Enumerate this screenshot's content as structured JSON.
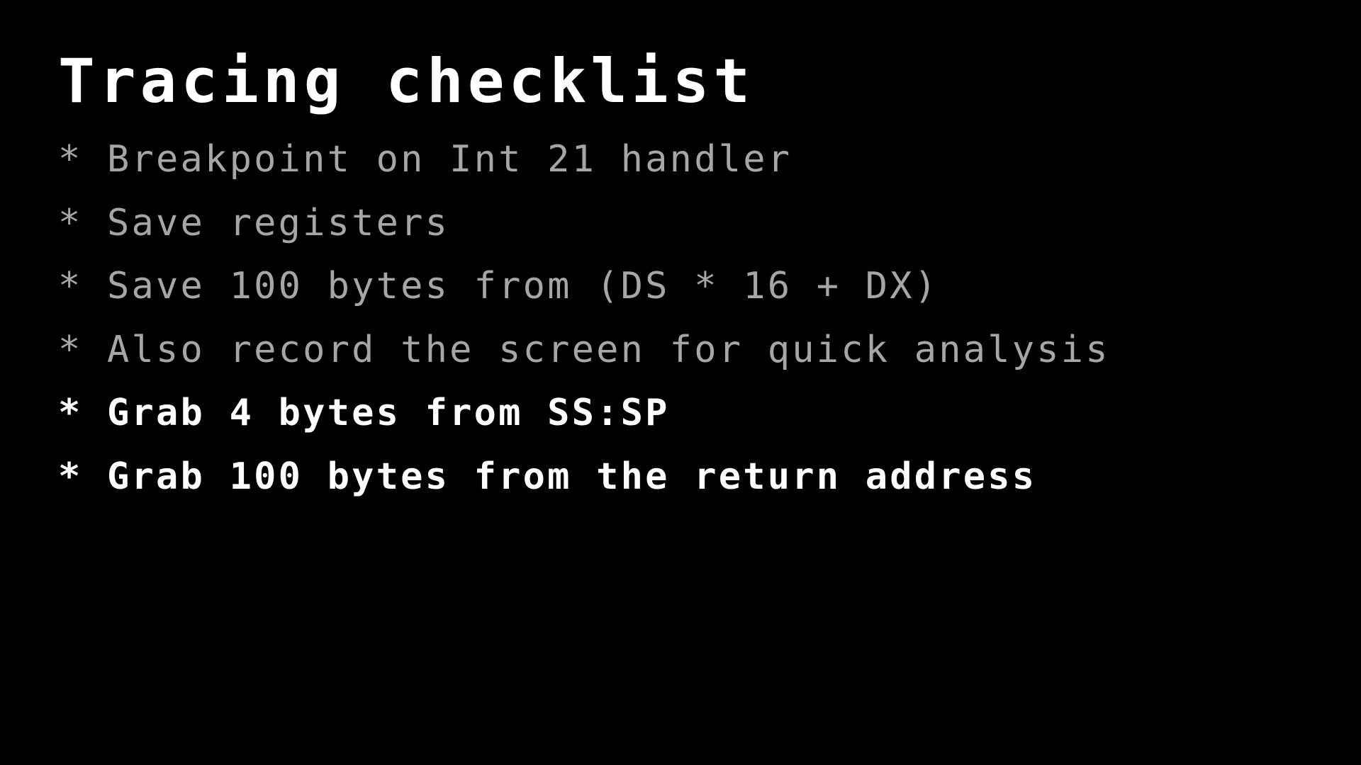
{
  "slide": {
    "background_color": "#000000",
    "title": "Tracing checklist",
    "title_color": "#ffffff",
    "dim_color": "#a6a6a6",
    "bullet_marker": "*",
    "bullets": [
      {
        "marker": "*",
        "text": "Breakpoint on Int 21 handler",
        "emphasis": "dim"
      },
      {
        "marker": "*",
        "text": "Save registers",
        "emphasis": "dim"
      },
      {
        "marker": "*",
        "text": "Save 100 bytes from (DS * 16 + DX)",
        "emphasis": "dim"
      },
      {
        "marker": "*",
        "text": "Also record the screen for quick analysis",
        "emphasis": "dim"
      },
      {
        "marker": "*",
        "text": "Grab 4 bytes from SS:SP",
        "emphasis": "strong"
      },
      {
        "marker": "*",
        "text": "Grab 100 bytes from the return address",
        "emphasis": "strong"
      }
    ]
  }
}
